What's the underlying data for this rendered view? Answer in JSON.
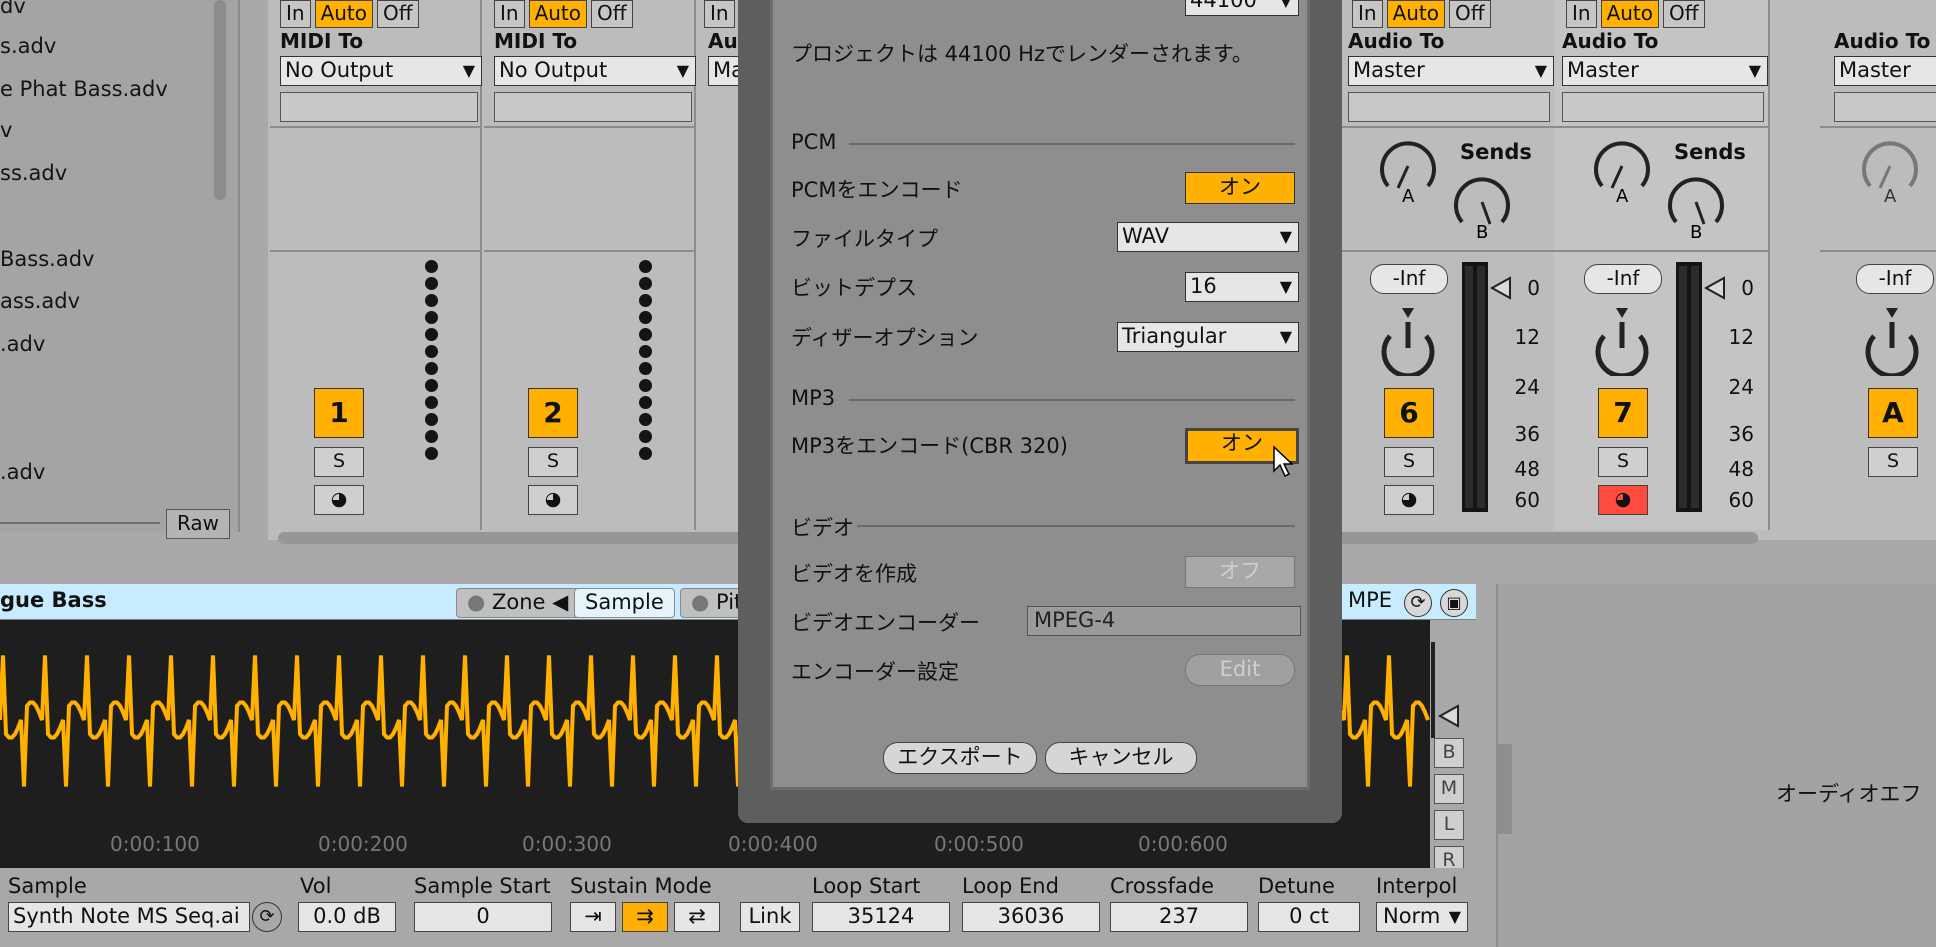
{
  "browser": {
    "items": [
      "dv",
      "s.adv",
      "e Phat Bass.adv",
      "v",
      "ss.adv",
      "Bass.adv",
      "ass.adv",
      ".adv",
      ".adv"
    ],
    "raw_label": "Raw"
  },
  "tracks": [
    {
      "mon": [
        "In",
        "Auto",
        "Off"
      ],
      "route_label": "MIDI To",
      "route_value": "No Output",
      "number": "1",
      "solo": "S"
    },
    {
      "mon": [
        "In",
        "Auto",
        "Off"
      ],
      "route_label": "MIDI To",
      "route_value": "No Output",
      "number": "2",
      "solo": "S"
    },
    {
      "mon_partial": "In",
      "route_label_partial": "Au",
      "route_value_partial": "Ma"
    },
    {
      "mon": [
        "In",
        "Auto",
        "Off"
      ],
      "route_label": "Audio To",
      "route_value": "Master",
      "number": "6",
      "solo": "S",
      "vol": "-Inf",
      "sends": "Sends",
      "send_a": "A",
      "send_b": "B"
    },
    {
      "mon": [
        "In",
        "Auto",
        "Off"
      ],
      "route_label": "Audio To",
      "route_value": "Master",
      "number": "7",
      "solo": "S",
      "vol": "-Inf",
      "sends": "Sends",
      "send_a": "A",
      "send_b": "B"
    },
    {
      "route_label": "Audio To",
      "route_value": "Master",
      "number": "A",
      "solo": "S",
      "vol": "-Inf",
      "send_a": "A"
    }
  ],
  "meter_scale": [
    "0",
    "12",
    "24",
    "36",
    "48",
    "60"
  ],
  "device": {
    "title": "gue Bass",
    "tabs": [
      "Zone",
      "Sample",
      "Pit"
    ],
    "mpe": "MPE",
    "timeline": [
      "0:00:100",
      "0:00:200",
      "0:00:300",
      "0:00:400",
      "0:00:500",
      "0:00:600"
    ],
    "side_buttons": [
      "B",
      "M",
      "L",
      "R"
    ],
    "right_text": "オーディオエフ",
    "params": {
      "sample_label": "Sample",
      "sample_value": "Synth Note MS Seq.ai",
      "vol_label": "Vol",
      "vol_value": "0.0 dB",
      "start_label": "Sample Start",
      "start_value": "0",
      "sustain_label": "Sustain Mode",
      "link_label": "Link",
      "loop_start_label": "Loop Start",
      "loop_start_value": "35124",
      "loop_end_label": "Loop End",
      "loop_end_value": "36036",
      "crossfade_label": "Crossfade",
      "crossfade_value": "237",
      "detune_label": "Detune",
      "detune_value": "0 ct",
      "interpol_label": "Interpol",
      "interpol_value": "Norm"
    }
  },
  "dialog": {
    "top_partial": "44100",
    "render_note": "プロジェクトは 44100 Hzでレンダーされます。",
    "pcm_header": "PCM",
    "pcm_encode_label": "PCMをエンコード",
    "pcm_encode_value": "オン",
    "filetype_label": "ファイルタイプ",
    "filetype_value": "WAV",
    "bitdepth_label": "ビットデプス",
    "bitdepth_value": "16",
    "dither_label": "ディザーオプション",
    "dither_value": "Triangular",
    "mp3_header": "MP3",
    "mp3_encode_label": "MP3をエンコード(CBR 320)",
    "mp3_encode_value": "オン",
    "video_header": "ビデオ",
    "video_create_label": "ビデオを作成",
    "video_create_value": "オフ",
    "video_encoder_label": "ビデオエンコーダー",
    "video_encoder_value": "MPEG-4",
    "encoder_settings_label": "エンコーダー設定",
    "encoder_settings_value": "Edit",
    "export_label": "エクスポート",
    "cancel_label": "キャンセル"
  },
  "colors": {
    "accent": "#ffb000",
    "record_red": "#ff4b3e",
    "device_bar": "#c7ecff",
    "waveform": "#ffb000"
  }
}
